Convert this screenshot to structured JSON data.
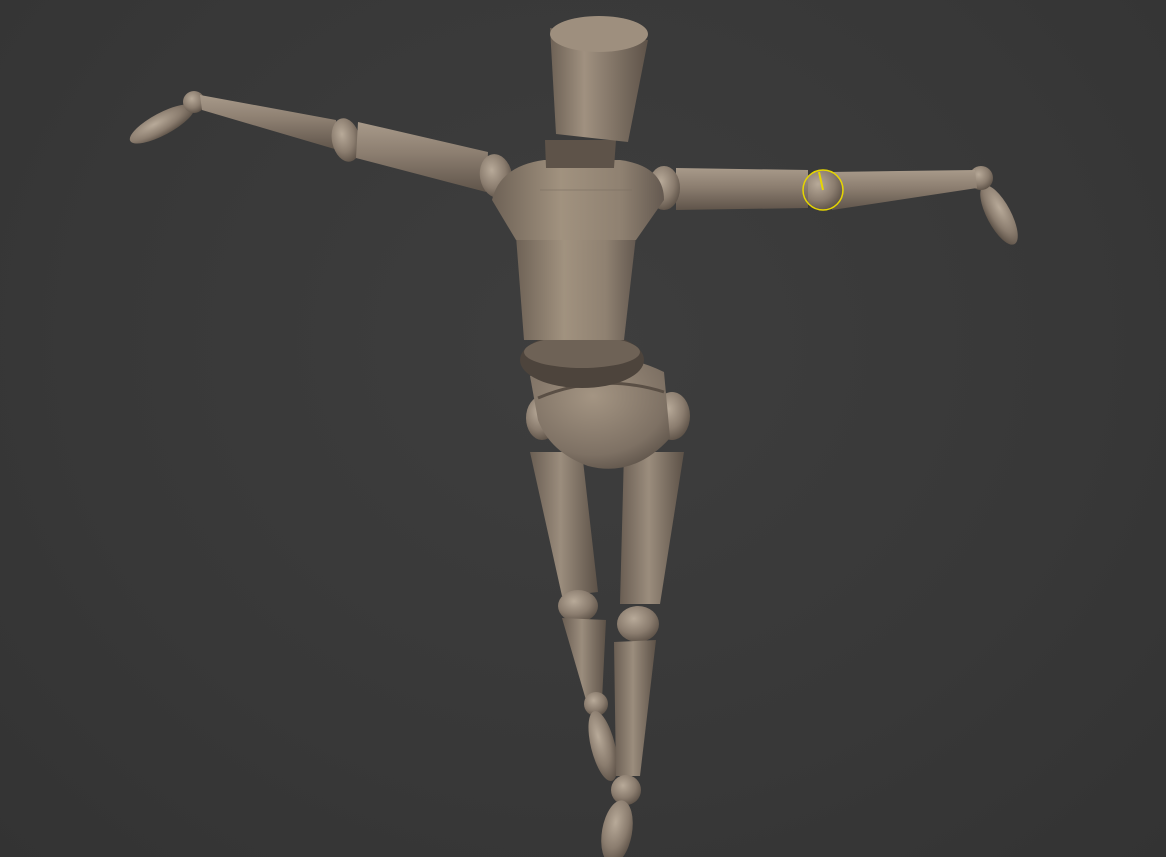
{
  "viewport": {
    "background": "#3a3a3a",
    "model_color": "#8c7e70",
    "model_shadow": "#5a4f45",
    "model_highlight": "#b3a595",
    "gizmo_color": "#e6d600",
    "object": "mannequin"
  }
}
